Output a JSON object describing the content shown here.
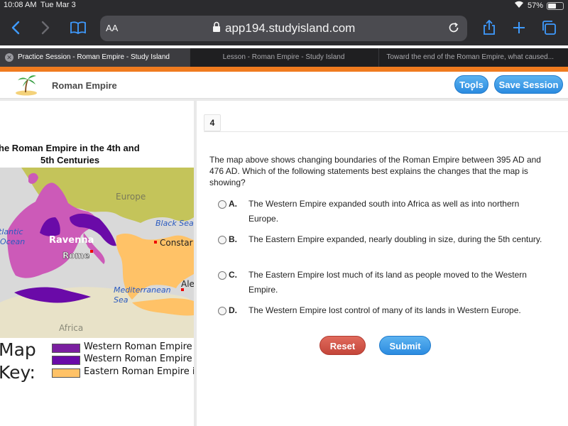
{
  "status": {
    "time": "10:08 AM",
    "date": "Tue Mar 3",
    "battery": "57%",
    "battery_level": 0.57
  },
  "browser": {
    "aa_label": "AA",
    "url": "app194.studyisland.com",
    "tabs": [
      {
        "label": "Practice Session - Roman Empire - Study Island"
      },
      {
        "label": "Lesson - Roman Empire - Study Island"
      },
      {
        "label": "Toward the end of the Roman Empire, what caused..."
      }
    ]
  },
  "app": {
    "title": "Roman Empire",
    "tools_label": "Tools",
    "save_label": "Save Session"
  },
  "map": {
    "title_line1": "he Roman Empire in the 4th and",
    "title_line2": "5th Centuries",
    "labels": {
      "europe": "Europe",
      "black_sea": "Black Sea",
      "atlantic_1": "tlantic",
      "atlantic_2": "Ocean",
      "ravenna": "Ravenna",
      "rome": "Rome",
      "constantinople": "Constar",
      "mediterranean_1": "Mediterranean",
      "mediterranean_2": "Sea",
      "alexandria": "Ale",
      "africa": "Africa"
    },
    "key_line1": "Map",
    "key_line2": "Key:",
    "legend": [
      {
        "label": "Western Roman Empire i",
        "color": "#7a1fa0"
      },
      {
        "label": "Western Roman Empire i",
        "color": "#6a0aa8"
      },
      {
        "label": "Eastern Roman Empire in",
        "color": "#ffc267"
      }
    ],
    "colors": {
      "sea": "#d9d9d9",
      "europe_land": "#c4c45a",
      "west_395": "#cc5ab8",
      "west_476": "#6a0aa8",
      "east": "#ffc267",
      "africa_land": "#e8e2c8"
    }
  },
  "question": {
    "number": "4",
    "text": "The map above shows changing boundaries of the Roman Empire between 395 AD and 476 AD. Which of the following statements best explains the changes that the map is showing?",
    "choices": [
      {
        "letter": "A.",
        "text": "The Western Empire expanded south into Africa as well as into northern Europe."
      },
      {
        "letter": "B.",
        "text": "The Eastern Empire expanded, nearly doubling in size, during the 5th century."
      },
      {
        "letter": "C.",
        "text": "The Eastern Empire lost much of its land as people moved to the Western Empire."
      },
      {
        "letter": "D.",
        "text": "The Western Empire lost control of many of its lands in Western Europe."
      }
    ],
    "reset_label": "Reset",
    "submit_label": "Submit"
  }
}
